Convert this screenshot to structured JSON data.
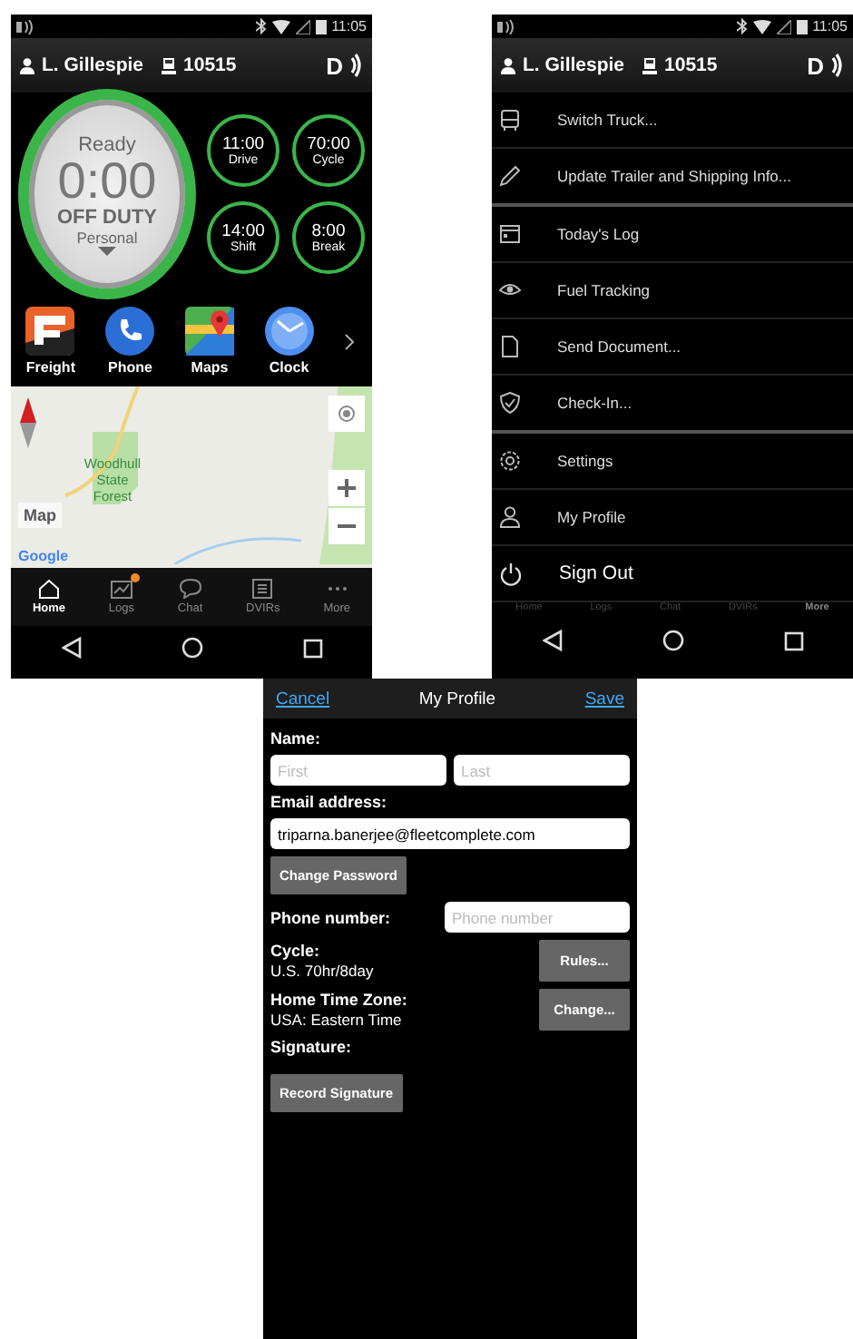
{
  "home_screen": {
    "status_bar": {
      "time": "11:05"
    },
    "header": {
      "driver": "L. Gillespie",
      "truck": "10515",
      "logo": "D"
    },
    "duty": {
      "state": "Ready",
      "timer": "0:00",
      "status": "OFF DUTY",
      "sub_status": "Personal"
    },
    "clocks": [
      {
        "value": "11:00",
        "label": "Drive"
      },
      {
        "value": "70:00",
        "label": "Cycle"
      },
      {
        "value": "14:00",
        "label": "Shift"
      },
      {
        "value": "8:00",
        "label": "Break"
      }
    ],
    "apps": [
      {
        "kind": "freight",
        "label": "Freight"
      },
      {
        "kind": "phone",
        "label": "Phone"
      },
      {
        "kind": "maps",
        "label": "Maps"
      },
      {
        "kind": "clock",
        "label": "Clock"
      }
    ],
    "map": {
      "place": "Woodhull State Forest",
      "type_button": "Map",
      "attribution": "Google"
    },
    "tabs": [
      {
        "kind": "home",
        "label": "Home",
        "selected": true,
        "badge": false
      },
      {
        "kind": "logs",
        "label": "Logs",
        "selected": false,
        "badge": true
      },
      {
        "kind": "chat",
        "label": "Chat",
        "selected": false,
        "badge": false
      },
      {
        "kind": "dvirs",
        "label": "DVIRs",
        "selected": false,
        "badge": false
      },
      {
        "kind": "more",
        "label": "More",
        "selected": false,
        "badge": false
      }
    ]
  },
  "menu_screen": {
    "status_bar": {
      "time": "11:05"
    },
    "header": {
      "driver": "L. Gillespie",
      "truck": "10515",
      "logo": "D"
    },
    "items": [
      {
        "kind": "truck",
        "label": "Switch Truck...",
        "divider_after": false
      },
      {
        "kind": "pencil",
        "label": "Update Trailer and Shipping Info...",
        "divider_after": true
      },
      {
        "kind": "calendar",
        "label": "Today's Log",
        "divider_after": false
      },
      {
        "kind": "eye",
        "label": "Fuel Tracking",
        "divider_after": false
      },
      {
        "kind": "document",
        "label": "Send Document...",
        "divider_after": false
      },
      {
        "kind": "check",
        "label": "Check-In...",
        "divider_after": true
      },
      {
        "kind": "gear",
        "label": "Settings",
        "divider_after": false
      },
      {
        "kind": "person",
        "label": "My Profile",
        "divider_after": false
      },
      {
        "kind": "power",
        "label": "Sign Out",
        "divider_after": false
      }
    ],
    "tabs": [
      {
        "label": "Home",
        "selected": false
      },
      {
        "label": "Logs",
        "selected": false
      },
      {
        "label": "Chat",
        "selected": false
      },
      {
        "label": "DVIRs",
        "selected": false
      },
      {
        "label": "More",
        "selected": true
      }
    ]
  },
  "profile_screen": {
    "cancel": "Cancel",
    "title": "My Profile",
    "save": "Save",
    "name_label": "Name:",
    "first_placeholder": "First",
    "last_placeholder": "Last",
    "email_label": "Email address:",
    "email": "triparna.banerjee@fleetcomplete.com",
    "change_password": "Change Password",
    "phone_label": "Phone number:",
    "phone_placeholder": "Phone number",
    "cycle_label": "Cycle:",
    "cycle": "U.S. 70hr/8day",
    "rules": "Rules...",
    "timezone_label": "Home Time Zone:",
    "timezone": "USA: Eastern Time",
    "change": "Change...",
    "signature_label": "Signature:",
    "record_signature": "Record Signature"
  }
}
